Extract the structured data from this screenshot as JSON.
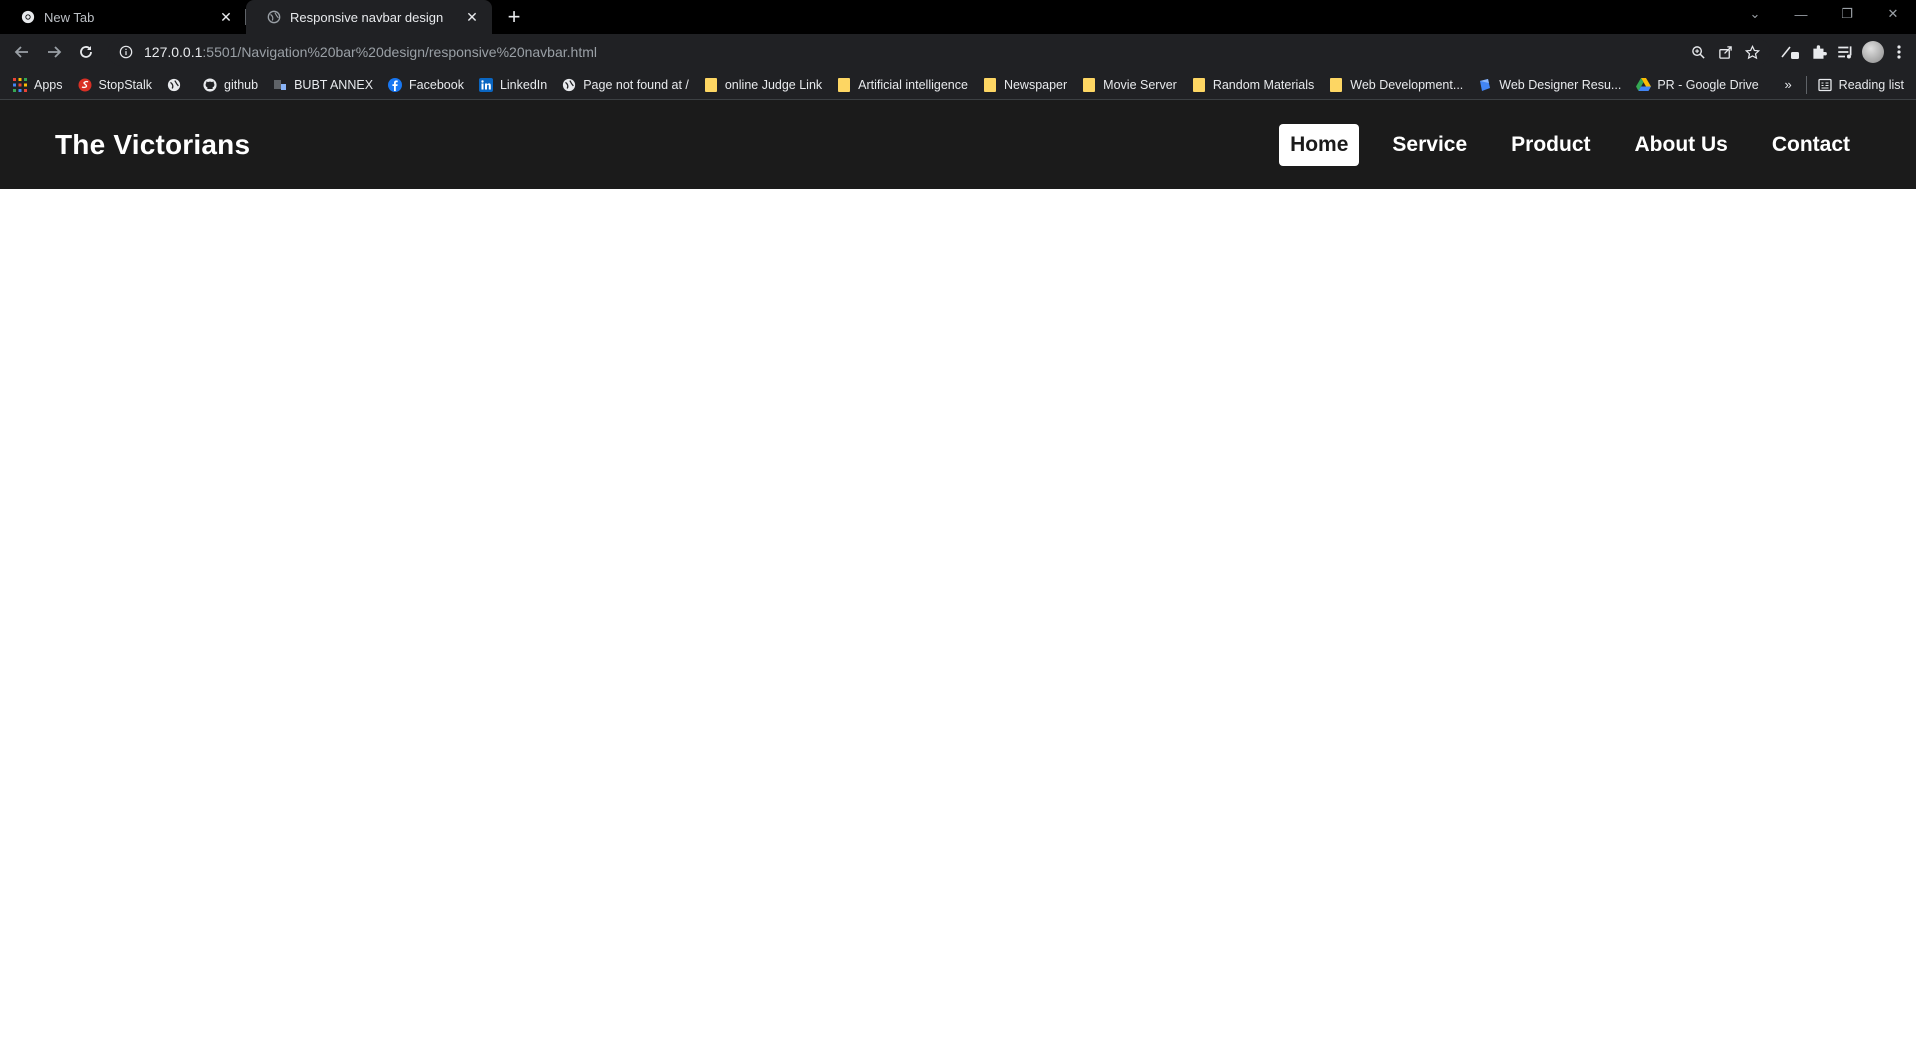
{
  "browser": {
    "tabs": [
      {
        "title": "New Tab",
        "active": false
      },
      {
        "title": "Responsive navbar design",
        "active": true
      }
    ],
    "address": {
      "host": "127.0.0.1",
      "path": ":5501/Navigation%20bar%20design/responsive%20navbar.html"
    },
    "bookmarks": [
      {
        "label": "Apps",
        "icon": "apps-grid-icon"
      },
      {
        "label": "StopStalk",
        "icon": "stopstalk-icon"
      },
      {
        "label": "",
        "icon": "globe-icon"
      },
      {
        "label": "github",
        "icon": "github-icon"
      },
      {
        "label": "BUBT ANNEX",
        "icon": "bubt-icon"
      },
      {
        "label": "Facebook",
        "icon": "facebook-icon"
      },
      {
        "label": "LinkedIn",
        "icon": "linkedin-icon"
      },
      {
        "label": "Page not found at /",
        "icon": "globe-icon"
      },
      {
        "label": "online Judge Link",
        "icon": "folder-icon"
      },
      {
        "label": "Artificial intelligence",
        "icon": "folder-icon"
      },
      {
        "label": "Newspaper",
        "icon": "folder-icon"
      },
      {
        "label": "Movie Server",
        "icon": "folder-icon"
      },
      {
        "label": "Random Materials",
        "icon": "folder-icon"
      },
      {
        "label": "Web Development...",
        "icon": "folder-icon"
      },
      {
        "label": "Web Designer Resu...",
        "icon": "webdesigner-icon"
      },
      {
        "label": "PR - Google Drive",
        "icon": "google-drive-icon"
      }
    ],
    "more_bookmarks": "»",
    "reading_list": "Reading list"
  },
  "site": {
    "logo": "The Victorians",
    "menu": [
      {
        "label": "Home",
        "active": true
      },
      {
        "label": "Service",
        "active": false
      },
      {
        "label": "Product",
        "active": false
      },
      {
        "label": "About Us",
        "active": false
      },
      {
        "label": "Contact",
        "active": false
      }
    ]
  },
  "colors": {
    "navbar_bg": "#1b1b1b",
    "active_item_bg": "#ffffff",
    "chrome_bg": "#202124"
  }
}
